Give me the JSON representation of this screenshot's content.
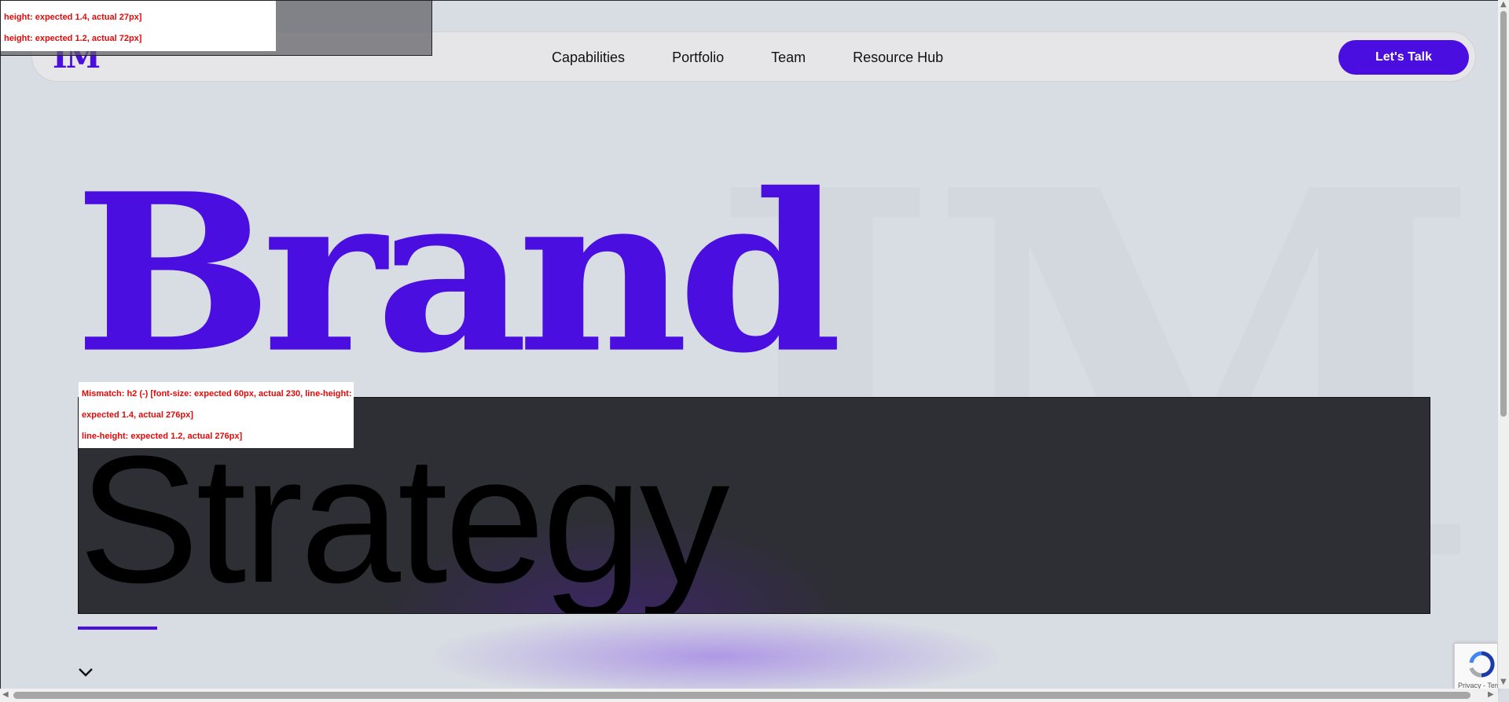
{
  "brand": {
    "logo": "IM",
    "accent_color": "#4b0ee0"
  },
  "watermark": {
    "text": "IM"
  },
  "nav": {
    "items": [
      "Capabilities",
      "Portfolio",
      "Team",
      "Resource Hub"
    ],
    "cta": "Let's Talk"
  },
  "hero": {
    "title_line1": "Brand",
    "title_line2": "Strategy"
  },
  "debug": {
    "top_line1": "height: expected 1.4, actual 27px]",
    "top_line2": "height: expected 1.2, actual 72px]",
    "mid_line1": "Mismatch: h2 (-) [font-size: expected 60px, actual 230, line-height:",
    "mid_line2": "expected 1.4, actual 276px]",
    "mid_line3": "line-height: expected 1.2, actual 276px]"
  },
  "recaptcha": {
    "text": "Privacy - Terms"
  },
  "icons": {
    "scroll_down": "chevron-down-icon",
    "recaptcha": "recaptcha-icon"
  }
}
